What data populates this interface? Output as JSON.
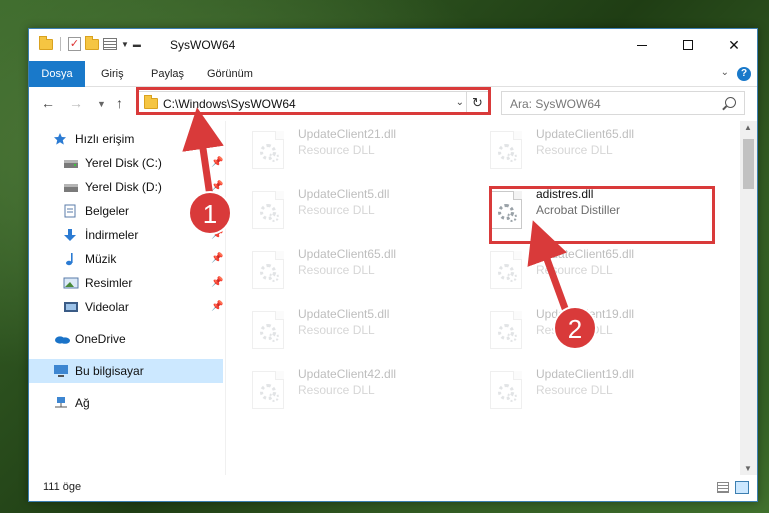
{
  "window": {
    "title": "SysWOW64"
  },
  "ribbon": {
    "tabs": [
      "Dosya",
      "Giriş",
      "Paylaş",
      "Görünüm"
    ]
  },
  "address": {
    "path": "C:\\Windows\\SysWOW64"
  },
  "search": {
    "placeholder": "Ara: SysWOW64"
  },
  "sidebar": {
    "items": [
      {
        "label": "Hızlı erişim",
        "icon": "star-icon"
      },
      {
        "label": "Yerel Disk (C:)",
        "icon": "drive-icon",
        "pinned": true
      },
      {
        "label": "Yerel Disk (D:)",
        "icon": "drive-icon",
        "pinned": true
      },
      {
        "label": "Belgeler",
        "icon": "document-icon",
        "pinned": true
      },
      {
        "label": "İndirmeler",
        "icon": "download-icon",
        "pinned": true
      },
      {
        "label": "Müzik",
        "icon": "music-icon",
        "pinned": true
      },
      {
        "label": "Resimler",
        "icon": "picture-icon",
        "pinned": true
      },
      {
        "label": "Videolar",
        "icon": "video-icon",
        "pinned": true
      },
      {
        "label": "OneDrive",
        "icon": "cloud-icon"
      },
      {
        "label": "Bu bilgisayar",
        "icon": "computer-icon",
        "selected": true
      },
      {
        "label": "Ağ",
        "icon": "network-icon"
      }
    ]
  },
  "files": [
    {
      "name": "UpdateClient21.dll",
      "type": "Resource DLL"
    },
    {
      "name": "UpdateClient65.dll",
      "type": "Resource DLL"
    },
    {
      "name": "UpdateClient5.dll",
      "type": "Resource DLL"
    },
    {
      "name": "adistres.dll",
      "type": "Acrobat Distiller"
    },
    {
      "name": "UpdateClient65.dll",
      "type": "Resource DLL"
    },
    {
      "name": "UpdateClient65.dll",
      "type": "Resource DLL"
    },
    {
      "name": "UpdateClient5.dll",
      "type": "Resource DLL"
    },
    {
      "name": "UpdateClient19.dll",
      "type": "Resource DLL"
    },
    {
      "name": "UpdateClient42.dll",
      "type": "Resource DLL"
    },
    {
      "name": "UpdateClient19.dll",
      "type": "Resource DLL"
    }
  ],
  "status": {
    "count": "111 öge"
  },
  "annotations": {
    "step1": "1",
    "step2": "2",
    "color": "#d93a3a"
  }
}
